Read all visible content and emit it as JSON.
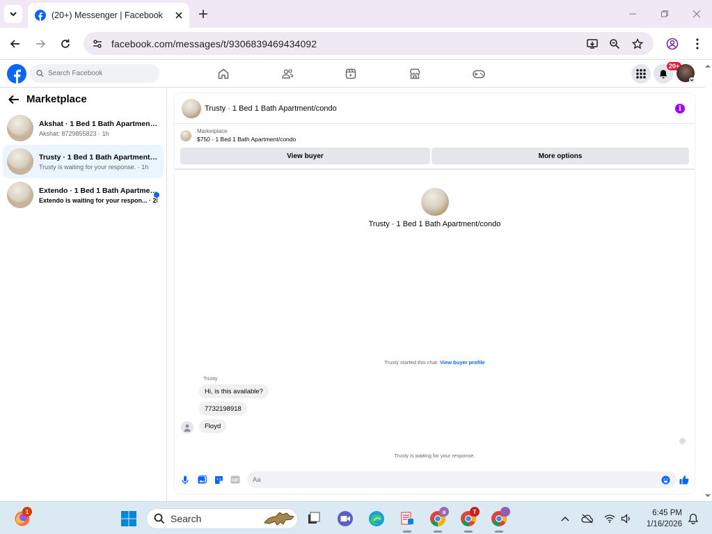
{
  "browser": {
    "tab_title": "(20+) Messenger | Facebook",
    "url": "facebook.com/messages/t/9306839469434092"
  },
  "fb": {
    "search_placeholder": "Search Facebook",
    "notification_badge": "20+"
  },
  "sidebar": {
    "title": "Marketplace",
    "conversations": [
      {
        "name": "Akshat · 1 Bed 1 Bath Apartment/c...",
        "preview": "Akshat: 8729855823 · 1h",
        "selected": false,
        "unread": false
      },
      {
        "name": "Trusty · 1 Bed 1 Bath Apartment/co...",
        "preview": "Trusty is waiting for your response. · 1h",
        "selected": true,
        "unread": false
      },
      {
        "name": "Extendo · 1 Bed 1 Bath Apartmen...",
        "preview": "Extendo is waiting for your respon... · 2h",
        "selected": false,
        "unread": true
      }
    ]
  },
  "chat": {
    "title": "Trusty · 1 Bed 1 Bath Apartment/condo",
    "listing_category": "Marketplace",
    "listing_title": "$750 - 1 Bed 1 Bath Apartment/condo",
    "view_buyer_label": "View buyer",
    "more_options_label": "More options",
    "profile_name": "Trusty · 1 Bed 1 Bath Apartment/condo",
    "started_text": "Trusty started this chat.",
    "started_link": "View buyer profile",
    "sender_label": "Trusty",
    "messages": [
      "Hi, is this available?",
      "7732198918",
      "Floyd"
    ],
    "waiting_text": "Trusty is waiting for your response.",
    "input_placeholder": "Aa"
  },
  "taskbar": {
    "search_label": "Search",
    "time": "6:45 PM",
    "date": "1/16/2026",
    "firefox_badge": "1",
    "chrome_profile_badges": [
      "a",
      "T",
      ""
    ]
  },
  "colors": {
    "fb_blue": "#0866ff",
    "info_purple": "#a200ff",
    "tab_strip": "#f0e9f5",
    "taskbar": "#dbe9f2"
  }
}
